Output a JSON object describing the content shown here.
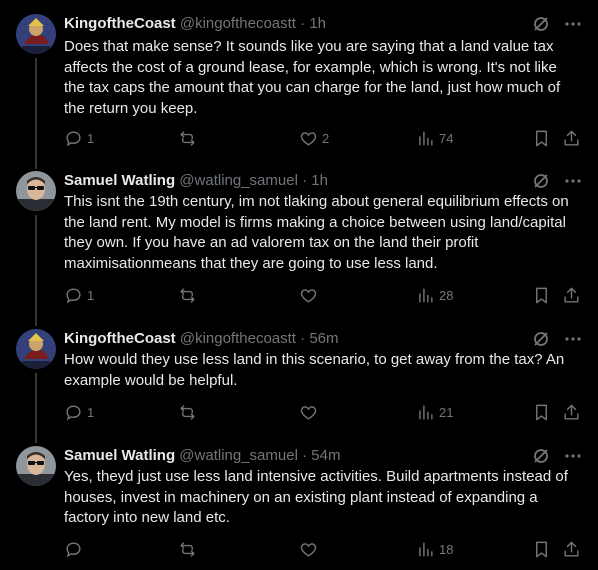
{
  "tweets": [
    {
      "name": "KingoftheCoast",
      "handle": "@kingofthecoastt",
      "sep": "·",
      "time": "1h",
      "text": "Does that make sense? It sounds like you are saying that a land value tax affects the cost of a ground lease, for example, which is wrong. It's not like the tax caps the amount that you can charge for the land, just how much of the return you keep.",
      "replies": "1",
      "retweets": "",
      "likes": "2",
      "views": "74"
    },
    {
      "name": "Samuel Watling",
      "handle": "@watling_samuel",
      "sep": "·",
      "time": "1h",
      "text": "This isnt the 19th century, im not tlaking about general equilibrium effects on the land rent. My model is firms making a choice between using land/capital they own. If you have an ad valorem tax on the land their profit maximisationmeans that they are going to use less land.",
      "replies": "1",
      "retweets": "",
      "likes": "",
      "views": "28"
    },
    {
      "name": "KingoftheCoast",
      "handle": "@kingofthecoastt",
      "sep": "·",
      "time": "56m",
      "text": "How would they use less land in this scenario, to get away from the tax? An example would be helpful.",
      "replies": "1",
      "retweets": "",
      "likes": "",
      "views": "21"
    },
    {
      "name": "Samuel Watling",
      "handle": "@watling_samuel",
      "sep": "·",
      "time": "54m",
      "text": "Yes, theyd just use less land intensive activities. Build apartments instead of houses, invest in machinery on an existing plant instead of expanding a factory into new land etc.",
      "replies": "",
      "retweets": "",
      "likes": "",
      "views": "18"
    }
  ],
  "colors": {
    "background": "#000000",
    "text": "#e7e9ea",
    "muted": "#71767b",
    "thread_line": "#333639"
  }
}
